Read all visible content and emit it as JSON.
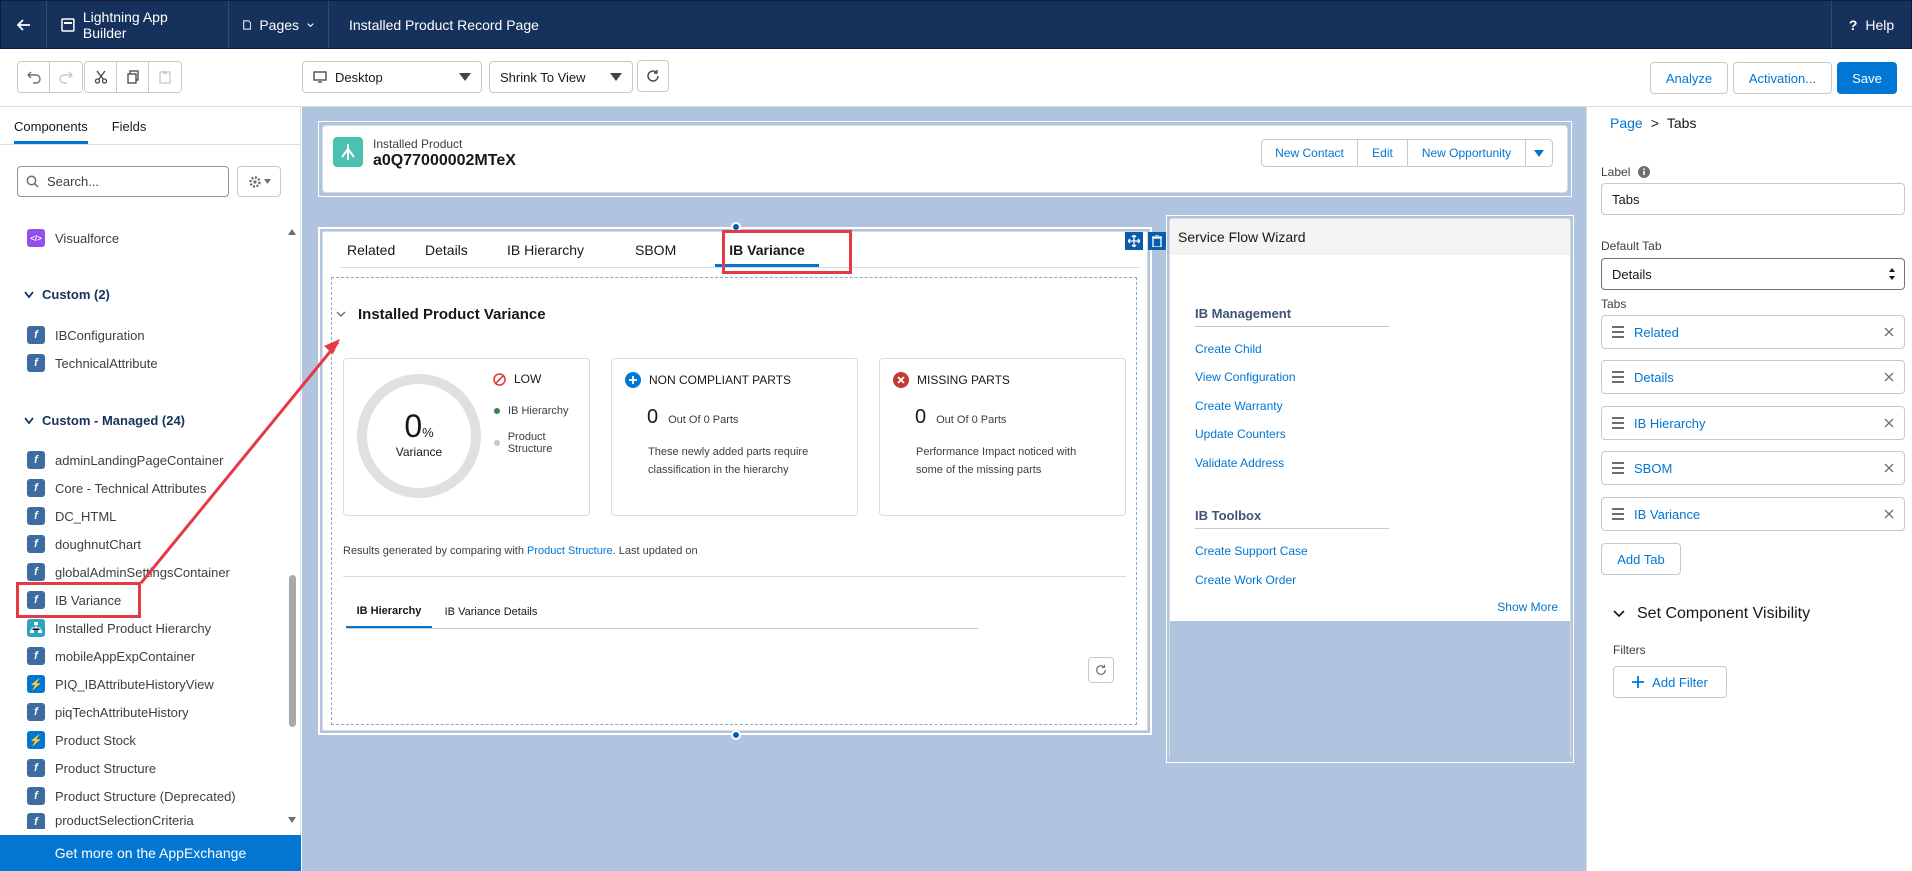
{
  "topbar": {
    "app_name": "Lightning App Builder",
    "pages_label": "Pages",
    "page_title": "Installed Product Record Page",
    "help_label": "Help"
  },
  "toolbar": {
    "device_value": "Desktop",
    "zoom_value": "Shrink To View",
    "analyze_label": "Analyze",
    "activation_label": "Activation...",
    "save_label": "Save"
  },
  "left_panel": {
    "tabs": [
      "Components",
      "Fields"
    ],
    "search_placeholder": "Search...",
    "visualforce_label": "Visualforce",
    "custom_group": "Custom (2)",
    "custom_items": [
      "IBConfiguration",
      "TechnicalAttribute"
    ],
    "managed_group": "Custom - Managed (24)",
    "managed_items": [
      "adminLandingPageContainer",
      "Core - Technical Attributes",
      "DC_HTML",
      "doughnutChart",
      "globalAdminSettingsContainer",
      "IB Variance",
      "Installed Product Hierarchy",
      "mobileAppExpContainer",
      "PIQ_IBAttributeHistoryView",
      "piqTechAttributeHistory",
      "Product Stock",
      "Product Structure",
      "Product Structure (Deprecated)",
      "productSelectionCriteria"
    ],
    "appexchange_label": "Get more on the AppExchange"
  },
  "record": {
    "object_label": "Installed Product",
    "record_name": "a0Q77000002MTeX",
    "actions": [
      "New Contact",
      "Edit",
      "New Opportunity"
    ]
  },
  "main_tabs": [
    "Related",
    "Details",
    "IB Hierarchy",
    "SBOM",
    "IB Variance"
  ],
  "variance": {
    "section_title": "Installed Product Variance",
    "percent_value": "0",
    "percent_sign": "%",
    "variance_label": "Variance",
    "level_label": "LOW",
    "legend": [
      "IB Hierarchy",
      "Product Structure"
    ],
    "non_compliant": {
      "title": "NON COMPLIANT PARTS",
      "count": "0",
      "of_text": "Out Of 0 Parts",
      "desc_line1": "These newly added parts require",
      "desc_line2": "classification in the hierarchy"
    },
    "missing": {
      "title": "MISSING PARTS",
      "count": "0",
      "of_text": "Out Of 0 Parts",
      "desc_line1": "Performance Impact noticed with",
      "desc_line2": "some of the missing parts"
    },
    "results_prefix": "Results generated by comparing with",
    "results_link": "Product Structure",
    "results_suffix": ". Last updated on",
    "subtabs": [
      "IB Hierarchy",
      "IB Variance Details"
    ]
  },
  "wizard": {
    "title": "Service Flow Wizard",
    "group1_title": "IB Management",
    "group1_items": [
      "Create Child",
      "View Configuration",
      "Create Warranty",
      "Update Counters",
      "Validate Address"
    ],
    "group2_title": "IB Toolbox",
    "group2_items": [
      "Create Support Case",
      "Create Work Order"
    ],
    "show_more": "Show More"
  },
  "right_panel": {
    "breadcrumb_page": "Page",
    "breadcrumb_sep": ">",
    "breadcrumb_current": "Tabs",
    "label_caption": "Label",
    "label_value": "Tabs",
    "default_tab_caption": "Default Tab",
    "default_tab_value": "Details",
    "tabs_caption": "Tabs",
    "tab_items": [
      "Related",
      "Details",
      "IB Hierarchy",
      "SBOM",
      "IB Variance"
    ],
    "add_tab_label": "Add Tab",
    "visibility_title": "Set Component Visibility",
    "filters_caption": "Filters",
    "add_filter_label": "Add Filter"
  },
  "colors": {
    "topbar": "#16325c",
    "brand": "#0176d3",
    "highlight": "#e63946",
    "canvas": "#b0c4df"
  }
}
